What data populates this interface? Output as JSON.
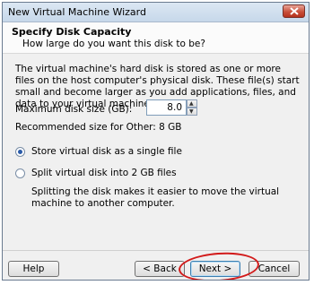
{
  "window": {
    "title": "New Virtual Machine Wizard"
  },
  "header": {
    "title": "Specify Disk Capacity",
    "subtitle": "How large do you want this disk to be?"
  },
  "body": {
    "description": "The virtual machine's hard disk is stored as one or more files on the host computer's physical disk. These file(s) start small and become larger as you add applications, files, and data to your virtual machine.",
    "max_size_label": "Maximum disk size (GB):",
    "max_size_value": "8.0",
    "recommended": "Recommended size for Other: 8 GB",
    "options": [
      {
        "label": "Store virtual disk as a single file",
        "selected": true
      },
      {
        "label": "Split virtual disk into 2 GB files",
        "selected": false
      }
    ],
    "split_help": "Splitting the disk makes it easier to move the virtual machine to another computer."
  },
  "footer": {
    "help": "Help",
    "back": "< Back",
    "next": "Next >",
    "cancel": "Cancel"
  },
  "colors": {
    "highlight": "#d21a1a",
    "close": "#c9503b"
  }
}
